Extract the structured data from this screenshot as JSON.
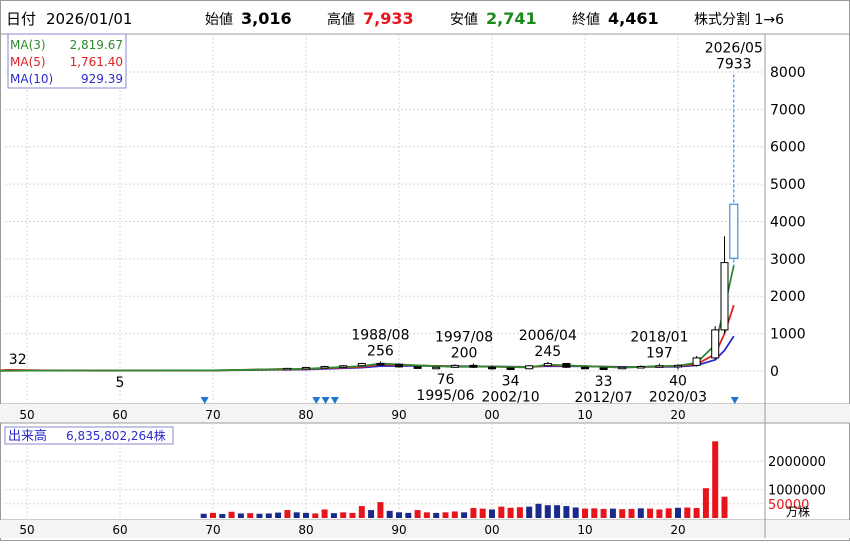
{
  "header": {
    "date_label": "日付",
    "date_value": "2026/01/01",
    "open_label": "始値",
    "open_value": "3,016",
    "high_label": "高値",
    "high_value": "7,933",
    "low_label": "安値",
    "low_value": "2,741",
    "close_label": "終値",
    "close_value": "4,461",
    "split_note": "株式分割 1→6"
  },
  "legend": [
    {
      "label": "MA(3)",
      "value": "2,819.67",
      "color": "#2e8b2e"
    },
    {
      "label": "MA(5)",
      "value": "1,761.40",
      "color": "#e02020"
    },
    {
      "label": "MA(10)",
      "value": "929.39",
      "color": "#2b2bd0"
    }
  ],
  "volume_label": "出来高",
  "volume_value": "6,835,802,264株",
  "volume_unit": "万株",
  "colors": {
    "up": "#e8141b",
    "down": "#1a2a8a",
    "ma3": "#2e8b2e",
    "ma5": "#e02020",
    "ma10": "#2b2bd0",
    "split_marker": "#1f77d0",
    "highlight_candle": "#1f77d0",
    "high_text": "#e8141b",
    "low_text": "#1a8a1a"
  },
  "chart_data": [
    {
      "type": "candlestick",
      "title": "",
      "xlabel": "",
      "ylabel": "",
      "x_ticks": [
        "50",
        "60",
        "70",
        "80",
        "90",
        "00",
        "10",
        "20"
      ],
      "x_range": [
        1945,
        2029
      ],
      "ylim": [
        -700,
        8900
      ],
      "y_ticks": [
        0,
        1000,
        2000,
        3000,
        4000,
        5000,
        6000,
        7000,
        8000
      ],
      "candles": [
        {
          "year": 1978,
          "open": 60,
          "high": 80,
          "low": 40,
          "close": 70
        },
        {
          "year": 1980,
          "open": 70,
          "high": 110,
          "low": 60,
          "close": 95
        },
        {
          "year": 1982,
          "open": 95,
          "high": 140,
          "low": 80,
          "close": 120
        },
        {
          "year": 1984,
          "open": 120,
          "high": 160,
          "low": 100,
          "close": 140
        },
        {
          "year": 1986,
          "open": 140,
          "high": 220,
          "low": 120,
          "close": 200
        },
        {
          "year": 1988,
          "open": 200,
          "high": 256,
          "low": 160,
          "close": 180
        },
        {
          "year": 1990,
          "open": 180,
          "high": 200,
          "low": 90,
          "close": 110
        },
        {
          "year": 1992,
          "open": 110,
          "high": 130,
          "low": 80,
          "close": 95
        },
        {
          "year": 1994,
          "open": 95,
          "high": 120,
          "low": 76,
          "close": 100
        },
        {
          "year": 1996,
          "open": 100,
          "high": 180,
          "low": 90,
          "close": 150
        },
        {
          "year": 1998,
          "open": 150,
          "high": 200,
          "low": 80,
          "close": 100
        },
        {
          "year": 2000,
          "open": 100,
          "high": 150,
          "low": 34,
          "close": 80
        },
        {
          "year": 2002,
          "open": 80,
          "high": 90,
          "low": 34,
          "close": 60
        },
        {
          "year": 2004,
          "open": 60,
          "high": 160,
          "low": 50,
          "close": 140
        },
        {
          "year": 2006,
          "open": 140,
          "high": 245,
          "low": 120,
          "close": 200
        },
        {
          "year": 2008,
          "open": 200,
          "high": 210,
          "low": 80,
          "close": 100
        },
        {
          "year": 2010,
          "open": 100,
          "high": 120,
          "low": 60,
          "close": 80
        },
        {
          "year": 2012,
          "open": 80,
          "high": 90,
          "low": 33,
          "close": 70
        },
        {
          "year": 2014,
          "open": 70,
          "high": 120,
          "low": 60,
          "close": 100
        },
        {
          "year": 2016,
          "open": 100,
          "high": 150,
          "low": 80,
          "close": 120
        },
        {
          "year": 2018,
          "open": 120,
          "high": 197,
          "low": 100,
          "close": 140
        },
        {
          "year": 2020,
          "open": 140,
          "high": 180,
          "low": 40,
          "close": 150
        },
        {
          "year": 2022,
          "open": 150,
          "high": 400,
          "low": 120,
          "close": 350
        },
        {
          "year": 2024,
          "open": 350,
          "high": 1200,
          "low": 300,
          "close": 1100
        },
        {
          "year": 2025,
          "open": 1100,
          "high": 3600,
          "low": 1000,
          "close": 2900
        },
        {
          "year": 2026,
          "open": 3016,
          "high": 7933,
          "low": 2741,
          "close": 4461,
          "highlight": true
        }
      ],
      "early_line": [
        [
          1946,
          5
        ],
        [
          1948,
          32
        ],
        [
          1955,
          8
        ],
        [
          1958,
          5
        ],
        [
          1970,
          10
        ],
        [
          1978,
          60
        ]
      ],
      "ma3": [
        [
          1946,
          5
        ],
        [
          1950,
          12
        ],
        [
          1970,
          15
        ],
        [
          1980,
          60
        ],
        [
          1986,
          130
        ],
        [
          1988,
          200
        ],
        [
          1992,
          150
        ],
        [
          1996,
          110
        ],
        [
          2000,
          120
        ],
        [
          2004,
          100
        ],
        [
          2006,
          170
        ],
        [
          2010,
          130
        ],
        [
          2014,
          90
        ],
        [
          2018,
          130
        ],
        [
          2020,
          140
        ],
        [
          2022,
          220
        ],
        [
          2024,
          700
        ],
        [
          2025,
          1700
        ],
        [
          2026,
          2819.67
        ]
      ],
      "ma5": [
        [
          1946,
          5
        ],
        [
          1950,
          12
        ],
        [
          1970,
          15
        ],
        [
          1980,
          50
        ],
        [
          1986,
          110
        ],
        [
          1988,
          170
        ],
        [
          1992,
          150
        ],
        [
          1996,
          120
        ],
        [
          2000,
          115
        ],
        [
          2004,
          100
        ],
        [
          2006,
          150
        ],
        [
          2010,
          130
        ],
        [
          2014,
          95
        ],
        [
          2018,
          120
        ],
        [
          2020,
          130
        ],
        [
          2022,
          180
        ],
        [
          2024,
          450
        ],
        [
          2025,
          1000
        ],
        [
          2026,
          1761.4
        ]
      ],
      "ma10": [
        [
          1946,
          5
        ],
        [
          1950,
          12
        ],
        [
          1970,
          15
        ],
        [
          1980,
          40
        ],
        [
          1986,
          90
        ],
        [
          1988,
          130
        ],
        [
          1992,
          140
        ],
        [
          1996,
          130
        ],
        [
          2000,
          120
        ],
        [
          2004,
          110
        ],
        [
          2006,
          130
        ],
        [
          2010,
          125
        ],
        [
          2014,
          110
        ],
        [
          2018,
          110
        ],
        [
          2020,
          115
        ],
        [
          2022,
          150
        ],
        [
          2024,
          300
        ],
        [
          2025,
          550
        ],
        [
          2026,
          929.39
        ]
      ],
      "annotations": [
        {
          "text": "5",
          "year": 1946,
          "value": 5,
          "pos": "below"
        },
        {
          "text": "32",
          "year": 1949,
          "value": 32,
          "pos": "above"
        },
        {
          "text": "5",
          "year": 1960,
          "value": 5,
          "pos": "below"
        },
        {
          "text": "1988/08",
          "year": 1988,
          "value": 256,
          "pos": "above2"
        },
        {
          "text": "256",
          "year": 1988,
          "value": 256,
          "pos": "above"
        },
        {
          "text": "76",
          "year": 1995,
          "value": 76,
          "pos": "below"
        },
        {
          "text": "1995/06",
          "year": 1995,
          "value": 76,
          "pos": "below2"
        },
        {
          "text": "1997/08",
          "year": 1997,
          "value": 200,
          "pos": "above2"
        },
        {
          "text": "200",
          "year": 1997,
          "value": 200,
          "pos": "above"
        },
        {
          "text": "34",
          "year": 2002,
          "value": 34,
          "pos": "below"
        },
        {
          "text": "2002/10",
          "year": 2002,
          "value": 34,
          "pos": "below2"
        },
        {
          "text": "2006/04",
          "year": 2006,
          "value": 245,
          "pos": "above2"
        },
        {
          "text": "245",
          "year": 2006,
          "value": 245,
          "pos": "above"
        },
        {
          "text": "33",
          "year": 2012,
          "value": 33,
          "pos": "below"
        },
        {
          "text": "2012/07",
          "year": 2012,
          "value": 33,
          "pos": "below2"
        },
        {
          "text": "2018/01",
          "year": 2018,
          "value": 197,
          "pos": "above2"
        },
        {
          "text": "197",
          "year": 2018,
          "value": 197,
          "pos": "above"
        },
        {
          "text": "40",
          "year": 2020,
          "value": 40,
          "pos": "below"
        },
        {
          "text": "2020/03",
          "year": 2020,
          "value": 40,
          "pos": "below2"
        },
        {
          "text": "2026/05",
          "year": 2026,
          "value": 7933,
          "pos": "above2"
        },
        {
          "text": "7933",
          "year": 2026,
          "value": 7933,
          "pos": "above"
        }
      ],
      "split_years": [
        1969,
        1981,
        1982,
        1983,
        2026
      ]
    },
    {
      "type": "bar",
      "title": "",
      "xlabel": "",
      "ylabel": "",
      "x_ticks": [
        "50",
        "60",
        "70",
        "80",
        "90",
        "00",
        "10",
        "20"
      ],
      "ylim": [
        0,
        2900000
      ],
      "y_ticks": [
        500000,
        1000000,
        2000000
      ],
      "y_tick_labels": [
        "50000",
        "1000000",
        "2000000"
      ],
      "bars": [
        {
          "year": 1969,
          "value": 150000,
          "dir": "down"
        },
        {
          "year": 1970,
          "value": 180000,
          "dir": "up"
        },
        {
          "year": 1971,
          "value": 140000,
          "dir": "down"
        },
        {
          "year": 1972,
          "value": 220000,
          "dir": "up"
        },
        {
          "year": 1973,
          "value": 160000,
          "dir": "down"
        },
        {
          "year": 1974,
          "value": 170000,
          "dir": "up"
        },
        {
          "year": 1975,
          "value": 150000,
          "dir": "down"
        },
        {
          "year": 1976,
          "value": 160000,
          "dir": "down"
        },
        {
          "year": 1977,
          "value": 190000,
          "dir": "down"
        },
        {
          "year": 1978,
          "value": 280000,
          "dir": "up"
        },
        {
          "year": 1979,
          "value": 200000,
          "dir": "down"
        },
        {
          "year": 1980,
          "value": 180000,
          "dir": "down"
        },
        {
          "year": 1981,
          "value": 160000,
          "dir": "up"
        },
        {
          "year": 1982,
          "value": 300000,
          "dir": "up"
        },
        {
          "year": 1983,
          "value": 170000,
          "dir": "down"
        },
        {
          "year": 1984,
          "value": 200000,
          "dir": "up"
        },
        {
          "year": 1985,
          "value": 180000,
          "dir": "up"
        },
        {
          "year": 1986,
          "value": 420000,
          "dir": "up"
        },
        {
          "year": 1987,
          "value": 280000,
          "dir": "down"
        },
        {
          "year": 1988,
          "value": 560000,
          "dir": "up"
        },
        {
          "year": 1989,
          "value": 250000,
          "dir": "down"
        },
        {
          "year": 1990,
          "value": 200000,
          "dir": "down"
        },
        {
          "year": 1991,
          "value": 180000,
          "dir": "down"
        },
        {
          "year": 1992,
          "value": 280000,
          "dir": "up"
        },
        {
          "year": 1993,
          "value": 200000,
          "dir": "up"
        },
        {
          "year": 1994,
          "value": 180000,
          "dir": "down"
        },
        {
          "year": 1995,
          "value": 200000,
          "dir": "up"
        },
        {
          "year": 1996,
          "value": 230000,
          "dir": "up"
        },
        {
          "year": 1997,
          "value": 200000,
          "dir": "down"
        },
        {
          "year": 1998,
          "value": 350000,
          "dir": "up"
        },
        {
          "year": 1999,
          "value": 330000,
          "dir": "up"
        },
        {
          "year": 2000,
          "value": 300000,
          "dir": "down"
        },
        {
          "year": 2001,
          "value": 400000,
          "dir": "up"
        },
        {
          "year": 2002,
          "value": 360000,
          "dir": "up"
        },
        {
          "year": 2003,
          "value": 380000,
          "dir": "up"
        },
        {
          "year": 2004,
          "value": 400000,
          "dir": "down"
        },
        {
          "year": 2005,
          "value": 500000,
          "dir": "down"
        },
        {
          "year": 2006,
          "value": 450000,
          "dir": "down"
        },
        {
          "year": 2007,
          "value": 450000,
          "dir": "down"
        },
        {
          "year": 2008,
          "value": 420000,
          "dir": "down"
        },
        {
          "year": 2009,
          "value": 370000,
          "dir": "down"
        },
        {
          "year": 2010,
          "value": 330000,
          "dir": "up"
        },
        {
          "year": 2011,
          "value": 340000,
          "dir": "up"
        },
        {
          "year": 2012,
          "value": 320000,
          "dir": "up"
        },
        {
          "year": 2013,
          "value": 330000,
          "dir": "down"
        },
        {
          "year": 2014,
          "value": 310000,
          "dir": "up"
        },
        {
          "year": 2015,
          "value": 320000,
          "dir": "up"
        },
        {
          "year": 2016,
          "value": 340000,
          "dir": "down"
        },
        {
          "year": 2017,
          "value": 330000,
          "dir": "up"
        },
        {
          "year": 2018,
          "value": 300000,
          "dir": "up"
        },
        {
          "year": 2019,
          "value": 340000,
          "dir": "up"
        },
        {
          "year": 2020,
          "value": 360000,
          "dir": "down"
        },
        {
          "year": 2021,
          "value": 370000,
          "dir": "up"
        },
        {
          "year": 2022,
          "value": 350000,
          "dir": "up"
        },
        {
          "year": 2023,
          "value": 1050000,
          "dir": "up"
        },
        {
          "year": 2024,
          "value": 2700000,
          "dir": "up"
        },
        {
          "year": 2025,
          "value": 750000,
          "dir": "up"
        }
      ]
    }
  ]
}
